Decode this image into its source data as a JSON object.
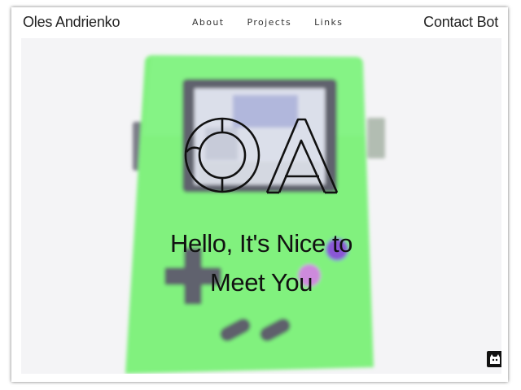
{
  "nav": {
    "brand": "Oles Andrienko",
    "links": [
      {
        "label": "About"
      },
      {
        "label": "Projects"
      },
      {
        "label": "Links"
      }
    ],
    "contact": "Contact Bot"
  },
  "hero": {
    "logo_icon": "oa-monogram-logo",
    "greeting_line1": "Hello, It's Nice to",
    "greeting_line2": "Meet You"
  },
  "footer": {
    "github_icon": "github-octocat-icon"
  },
  "colors": {
    "console_green": "#6fef72",
    "text": "#111111"
  }
}
